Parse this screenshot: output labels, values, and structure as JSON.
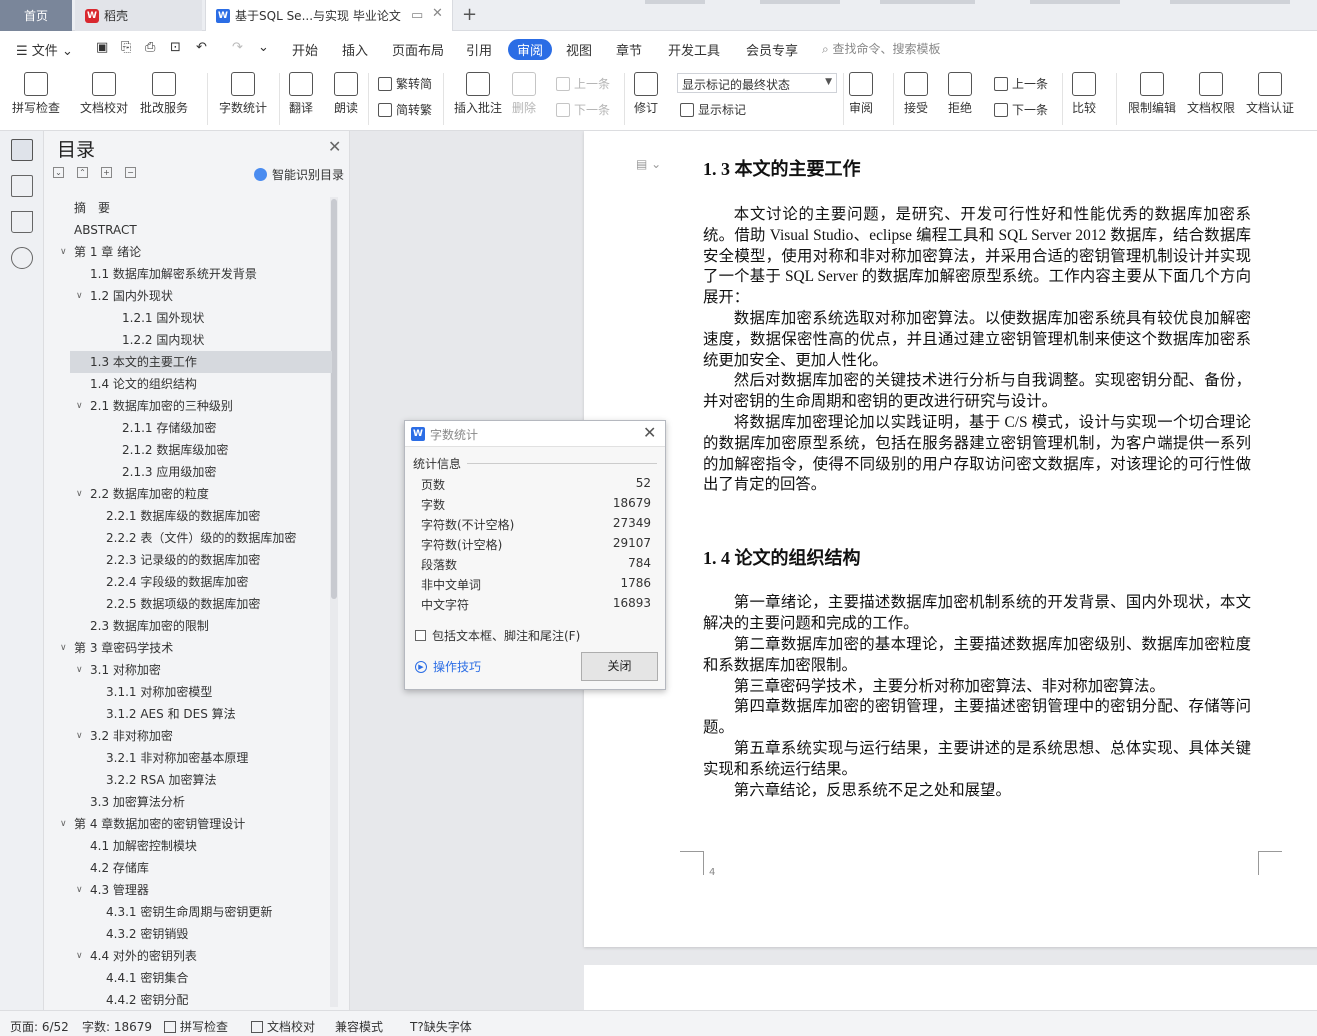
{
  "tabs": {
    "home": "首页",
    "wk": "稻壳",
    "doc": "基于SQL Se...与实现 毕业论文"
  },
  "menu": {
    "file": "文件",
    "items": [
      "开始",
      "插入",
      "页面布局",
      "引用",
      "审阅",
      "视图",
      "章节",
      "开发工具",
      "会员专享"
    ],
    "search": "查找命令、搜索模板"
  },
  "ribbon": {
    "spell": "拼写检查",
    "proof": "文档校对",
    "approve": "批改服务",
    "wordcount": "字数统计",
    "translate": "翻译",
    "read": "朗读",
    "trad": "繁转简",
    "simp": "简转繁",
    "insert_comment": "插入批注",
    "delete": "删除",
    "prev": "上一条",
    "next": "下一条",
    "revise": "修订",
    "markup_state": "显示标记的最终状态",
    "show_markup": "显示标记",
    "review": "审阅",
    "accept": "接受",
    "reject": "拒绝",
    "prev2": "上一条",
    "next2": "下一条",
    "compare": "比较",
    "restrict": "限制编辑",
    "perm": "文档权限",
    "cert": "文档认证"
  },
  "toc": {
    "title": "目录",
    "smart": "智能识别目录",
    "items": [
      {
        "text": "摘　要",
        "level": 0,
        "arrow": false
      },
      {
        "text": "ABSTRACT",
        "level": 0,
        "arrow": false
      },
      {
        "text": "第 1 章  绪论",
        "level": 0,
        "arrow": true
      },
      {
        "text": "1.1  数据库加解密系统开发背景",
        "level": 1,
        "arrow": false
      },
      {
        "text": "1.2  国内外现状",
        "level": 1,
        "arrow": true
      },
      {
        "text": "1.2.1  国外现状",
        "level": 2,
        "arrow": false
      },
      {
        "text": "1.2.2  国内现状",
        "level": 2,
        "arrow": false
      },
      {
        "text": "1.3  本文的主要工作",
        "level": 1,
        "arrow": false,
        "active": true
      },
      {
        "text": "1.4  论文的组织结构",
        "level": 1,
        "arrow": false
      },
      {
        "text": "2.1  数据库加密的三种级别",
        "level": 1,
        "arrow": true
      },
      {
        "text": "2.1.1  存储级加密",
        "level": 2,
        "arrow": false
      },
      {
        "text": "2.1.2  数据库级加密",
        "level": 2,
        "arrow": false
      },
      {
        "text": "2.1.3  应用级加密",
        "level": 2,
        "arrow": false
      },
      {
        "text": "2.2  数据库加密的粒度",
        "level": 1,
        "arrow": true
      },
      {
        "text": "2.2.1  数据库级的数据库加密",
        "level": 3,
        "arrow": false
      },
      {
        "text": "2.2.2  表（文件）级的的数据库加密",
        "level": 3,
        "arrow": false
      },
      {
        "text": "2.2.3  记录级的的数据库加密",
        "level": 3,
        "arrow": false
      },
      {
        "text": "2.2.4  字段级的数据库加密",
        "level": 3,
        "arrow": false
      },
      {
        "text": "2.2.5  数据项级的数据库加密",
        "level": 3,
        "arrow": false
      },
      {
        "text": "2.3 数据库加密的限制",
        "level": 1,
        "arrow": false
      },
      {
        "text": "第 3 章密码学技术",
        "level": 0,
        "arrow": true
      },
      {
        "text": "3.1  对称加密",
        "level": 1,
        "arrow": true
      },
      {
        "text": "3.1.1  对称加密模型",
        "level": 3,
        "arrow": false
      },
      {
        "text": "3.1.2 AES 和 DES 算法",
        "level": 3,
        "arrow": false
      },
      {
        "text": "3.2  非对称加密",
        "level": 1,
        "arrow": true
      },
      {
        "text": "3.2.1  非对称加密基本原理",
        "level": 3,
        "arrow": false
      },
      {
        "text": "3.2.2 RSA 加密算法",
        "level": 3,
        "arrow": false
      },
      {
        "text": "3.3  加密算法分析",
        "level": 1,
        "arrow": false
      },
      {
        "text": "第 4 章数据加密的密钥管理设计",
        "level": 0,
        "arrow": true
      },
      {
        "text": "4.1 加解密控制模块",
        "level": 1,
        "arrow": false
      },
      {
        "text": "4.2  存储库",
        "level": 1,
        "arrow": false
      },
      {
        "text": "4.3  管理器",
        "level": 1,
        "arrow": true
      },
      {
        "text": "4.3.1  密钥生命周期与密钥更新",
        "level": 3,
        "arrow": false
      },
      {
        "text": "4.3.2  密钥销毁",
        "level": 3,
        "arrow": false
      },
      {
        "text": "4.4  对外的密钥列表",
        "level": 1,
        "arrow": true
      },
      {
        "text": "4.4.1  密钥集合",
        "level": 3,
        "arrow": false
      },
      {
        "text": "4.4.2  密钥分配",
        "level": 3,
        "arrow": false
      }
    ]
  },
  "doc": {
    "h13": "1. 3  本文的主要工作",
    "p1": "本文讨论的主要问题，是研究、开发可行性好和性能优秀的数据库加密系统。借助 Visual Studio、eclipse 编程工具和 SQL Server 2012 数据库，结合数据库安全模型，使用对称和非对称加密算法，并采用合适的密钥管理机制设计并实现了一个基于 SQL Server 的数据库加解密原型系统。工作内容主要从下面几个方向展开：",
    "p2": "数据库加密系统选取对称加密算法。以使数据库加密系统具有较优良加解密速度，数据保密性高的优点，并且通过建立密钥管理机制来使这个数据库加密系统更加安全、更加人性化。",
    "p3": "然后对数据库加密的关键技术进行分析与自我调整。实现密钥分配、备份，并对密钥的生命周期和密钥的更改进行研究与设计。",
    "p4": "将数据库加密理论加以实践证明，基于 C/S 模式，设计与实现一个切合理论的数据库加密原型系统，包括在服务器建立密钥管理机制，为客户端提供一系列的加解密指令，使得不同级别的用户存取访问密文数据库，对该理论的可行性做出了肯定的回答。",
    "h14": "1. 4  论文的组织结构",
    "q1": "第一章绪论，主要描述数据库加密机制系统的开发背景、国内外现状，本文解决的主要问题和完成的工作。",
    "q2": "第二章数据库加密的基本理论，主要描述数据库加密级别、数据库加密粒度和系数据库加密限制。",
    "q3": "第三章密码学技术，主要分析对称加密算法、非对称加密算法。",
    "q4": "第四章数据库加密的密钥管理，主要描述密钥管理中的密钥分配、存储等问题。",
    "q5": "第五章系统实现与运行结果，主要讲述的是系统思想、总体实现、具体关键实现和系统运行结果。",
    "q6": "第六章结论，反思系统不足之处和展望。",
    "page_number": "4"
  },
  "dialog": {
    "title": "字数统计",
    "group": "统计信息",
    "stats": [
      {
        "k": "页数",
        "v": "52"
      },
      {
        "k": "字数",
        "v": "18679"
      },
      {
        "k": "字符数(不计空格)",
        "v": "27349"
      },
      {
        "k": "字符数(计空格)",
        "v": "29107"
      },
      {
        "k": "段落数",
        "v": "784"
      },
      {
        "k": "非中文单词",
        "v": "1786"
      },
      {
        "k": "中文字符",
        "v": "16893"
      }
    ],
    "checkbox": "包括文本框、脚注和尾注(F)",
    "tips": "操作技巧",
    "close": "关闭"
  },
  "status": {
    "page": "页面: 6/52",
    "words": "字数: 18679",
    "spell": "拼写检查",
    "proof": "文档校对",
    "compat": "兼容模式",
    "missing_font": "缺失字体"
  },
  "colors": {
    "accent": "#2b6de5",
    "home_tab": "#7a869a"
  }
}
